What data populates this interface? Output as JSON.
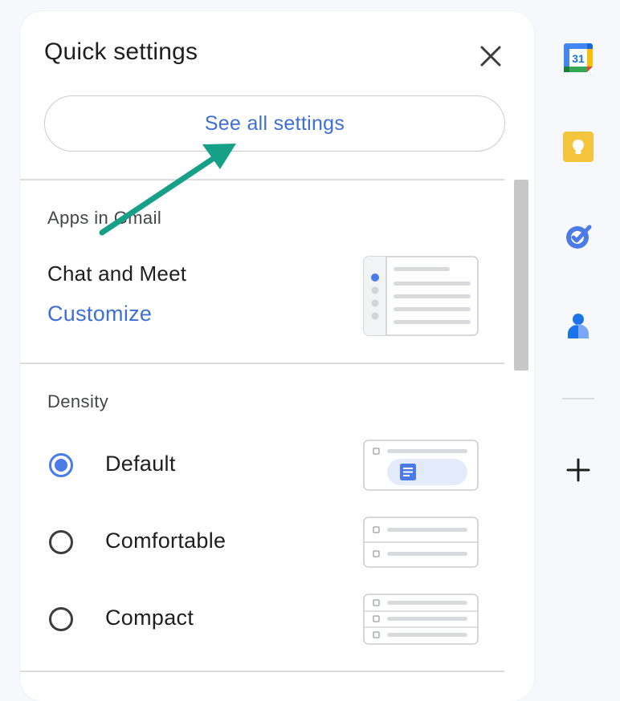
{
  "panel": {
    "title": "Quick settings",
    "see_all_label": "See all settings"
  },
  "apps_section": {
    "heading": "Apps in Gmail",
    "chat_label": "Chat and Meet",
    "customize_label": "Customize"
  },
  "density_section": {
    "heading": "Density",
    "options": [
      {
        "label": "Default",
        "selected": true
      },
      {
        "label": "Comfortable",
        "selected": false
      },
      {
        "label": "Compact",
        "selected": false
      }
    ]
  },
  "rail": {
    "calendar_day": "31"
  },
  "colors": {
    "accent_blue": "#3f6fd6",
    "arrow_teal": "#17a088",
    "keep_yellow": "#f4c43a"
  }
}
